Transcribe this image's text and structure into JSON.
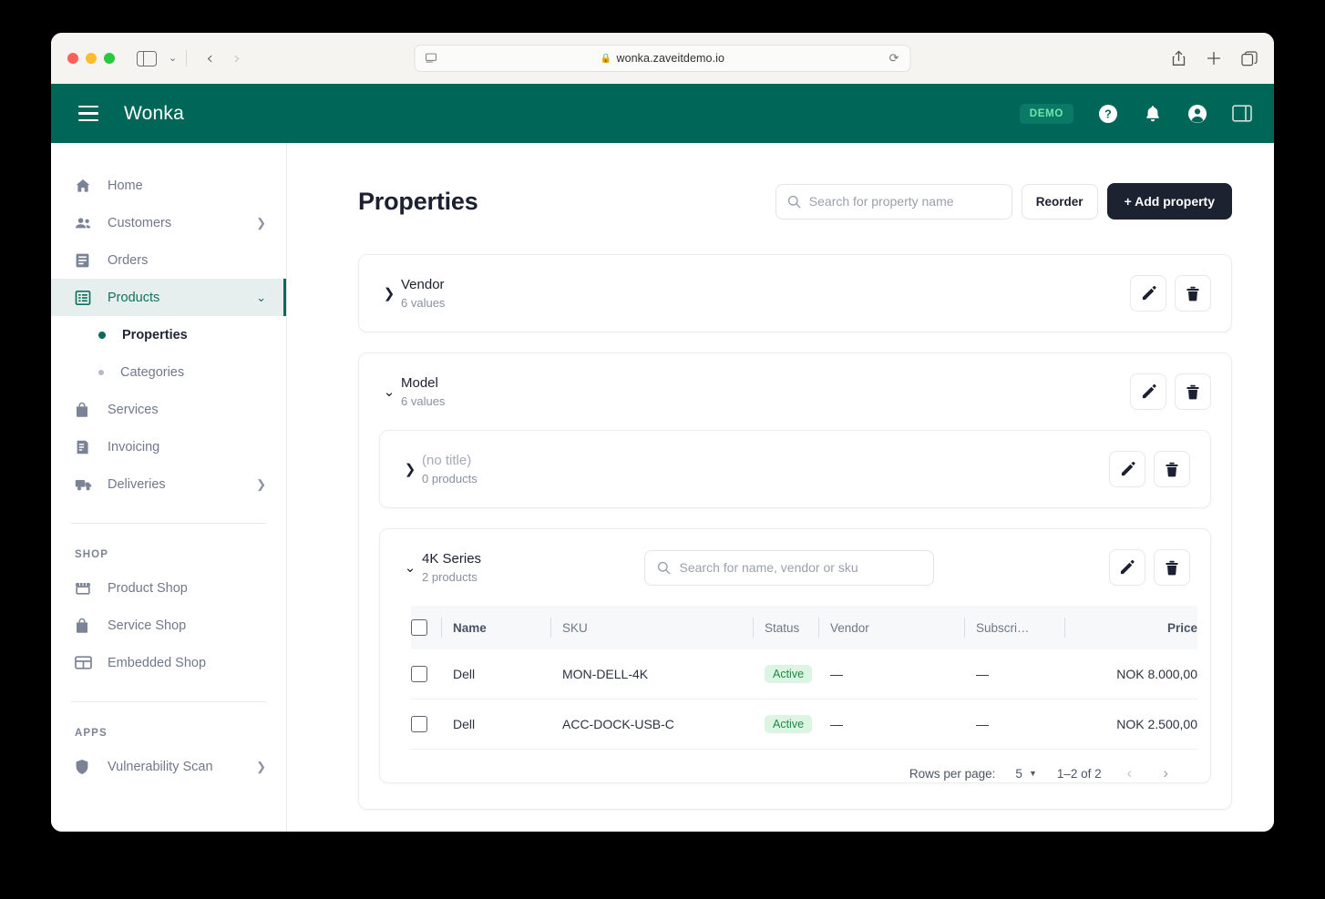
{
  "browser": {
    "url": "wonka.zaveitdemo.io",
    "lock_icon": "lock-icon",
    "reload_icon": "reload-icon",
    "sidebar_icon": "sidebar-toggle-icon",
    "back_icon": "back-arrow-icon",
    "forward_icon": "forward-arrow-icon",
    "share_icon": "share-icon",
    "new_tab_icon": "plus-icon",
    "tabs_icon": "tab-overview-icon"
  },
  "app_header": {
    "brand": "Wonka",
    "menu_icon": "hamburger-menu-icon",
    "demo_badge": "DEMO",
    "help_icon": "help-circle-icon",
    "notifications_icon": "bell-icon",
    "account_icon": "account-circle-icon",
    "panel_icon": "right-panel-icon",
    "bg_color": "#006657",
    "badge_text_color": "#6ee7a8"
  },
  "sidebar": {
    "items": [
      {
        "label": "Home",
        "icon": "home-icon",
        "chevron": false,
        "active": false
      },
      {
        "label": "Customers",
        "icon": "people-icon",
        "chevron": true,
        "active": false
      },
      {
        "label": "Orders",
        "icon": "orders-icon",
        "chevron": false,
        "active": false
      },
      {
        "label": "Products",
        "icon": "products-grid-icon",
        "chevron": true,
        "active": true,
        "expanded": true
      }
    ],
    "products_sub": [
      {
        "label": "Properties",
        "current": true
      },
      {
        "label": "Categories",
        "current": false
      }
    ],
    "items_after": [
      {
        "label": "Services",
        "icon": "services-bag-icon",
        "chevron": false
      },
      {
        "label": "Invoicing",
        "icon": "invoice-icon",
        "chevron": false
      },
      {
        "label": "Deliveries",
        "icon": "truck-icon",
        "chevron": true
      }
    ],
    "shop_section": {
      "title": "SHOP",
      "items": [
        {
          "label": "Product Shop",
          "icon": "storefront-icon",
          "chevron": false
        },
        {
          "label": "Service Shop",
          "icon": "service-bag-icon",
          "chevron": false
        },
        {
          "label": "Embedded Shop",
          "icon": "embedded-window-icon",
          "chevron": false
        }
      ]
    },
    "apps_section": {
      "title": "APPS",
      "items": [
        {
          "label": "Vulnerability Scan",
          "icon": "shield-icon",
          "chevron": true
        }
      ]
    },
    "accent_color": "#0c6a59",
    "active_bg": "#e6efed"
  },
  "main": {
    "title": "Properties",
    "search": {
      "placeholder": "Search for property name",
      "value": "",
      "icon": "search-icon"
    },
    "reorder_label": "Reorder",
    "add_property_label": "+ Add property",
    "properties": [
      {
        "name": "Vendor",
        "subtitle": "6 values",
        "expanded": false,
        "twisty_icon": "chevron-right-icon",
        "edit_icon": "pencil-icon",
        "delete_icon": "trash-icon"
      },
      {
        "name": "Model",
        "subtitle": "6 values",
        "expanded": true,
        "twisty_icon": "chevron-down-icon",
        "edit_icon": "pencil-icon",
        "delete_icon": "trash-icon"
      }
    ],
    "model_values": [
      {
        "name": "(no title)",
        "muted": true,
        "subtitle": "0 products",
        "expanded": false,
        "twisty_icon": "chevron-right-icon",
        "has_search": false,
        "edit_icon": "pencil-icon",
        "delete_icon": "trash-icon"
      },
      {
        "name": "4K Series",
        "muted": false,
        "subtitle": "2 products",
        "expanded": true,
        "twisty_icon": "chevron-down-icon",
        "has_search": true,
        "search_placeholder": "Search for name, vendor or sku",
        "search_value": "",
        "edit_icon": "pencil-icon",
        "delete_icon": "trash-icon"
      }
    ],
    "table": {
      "columns": [
        {
          "label": "",
          "key": "checkbox"
        },
        {
          "label": "Name",
          "key": "name",
          "bold": true
        },
        {
          "label": "SKU",
          "key": "sku",
          "bold": false
        },
        {
          "label": "Status",
          "key": "status",
          "bold": false
        },
        {
          "label": "Vendor",
          "key": "vendor",
          "bold": false
        },
        {
          "label": "Subscri…",
          "key": "subscription",
          "bold": false
        },
        {
          "label": "Price",
          "key": "price",
          "bold": true
        }
      ],
      "rows": [
        {
          "name": "Dell",
          "sku": "MON-DELL-4K",
          "status": "Active",
          "vendor": "—",
          "subscription": "—",
          "price": "NOK 8.000,00"
        },
        {
          "name": "Dell",
          "sku": "ACC-DOCK-USB-C",
          "status": "Active",
          "vendor": "—",
          "subscription": "—",
          "price": "NOK 2.500,00"
        }
      ],
      "status_badge_bg": "#dcf5e3",
      "status_badge_color": "#1f8a43"
    },
    "pagination": {
      "rows_per_page_label": "Rows per page:",
      "rows_per_page_value": "5",
      "range_label": "1–2 of 2",
      "prev_icon": "chevron-left-icon",
      "next_icon": "chevron-right-icon"
    }
  }
}
